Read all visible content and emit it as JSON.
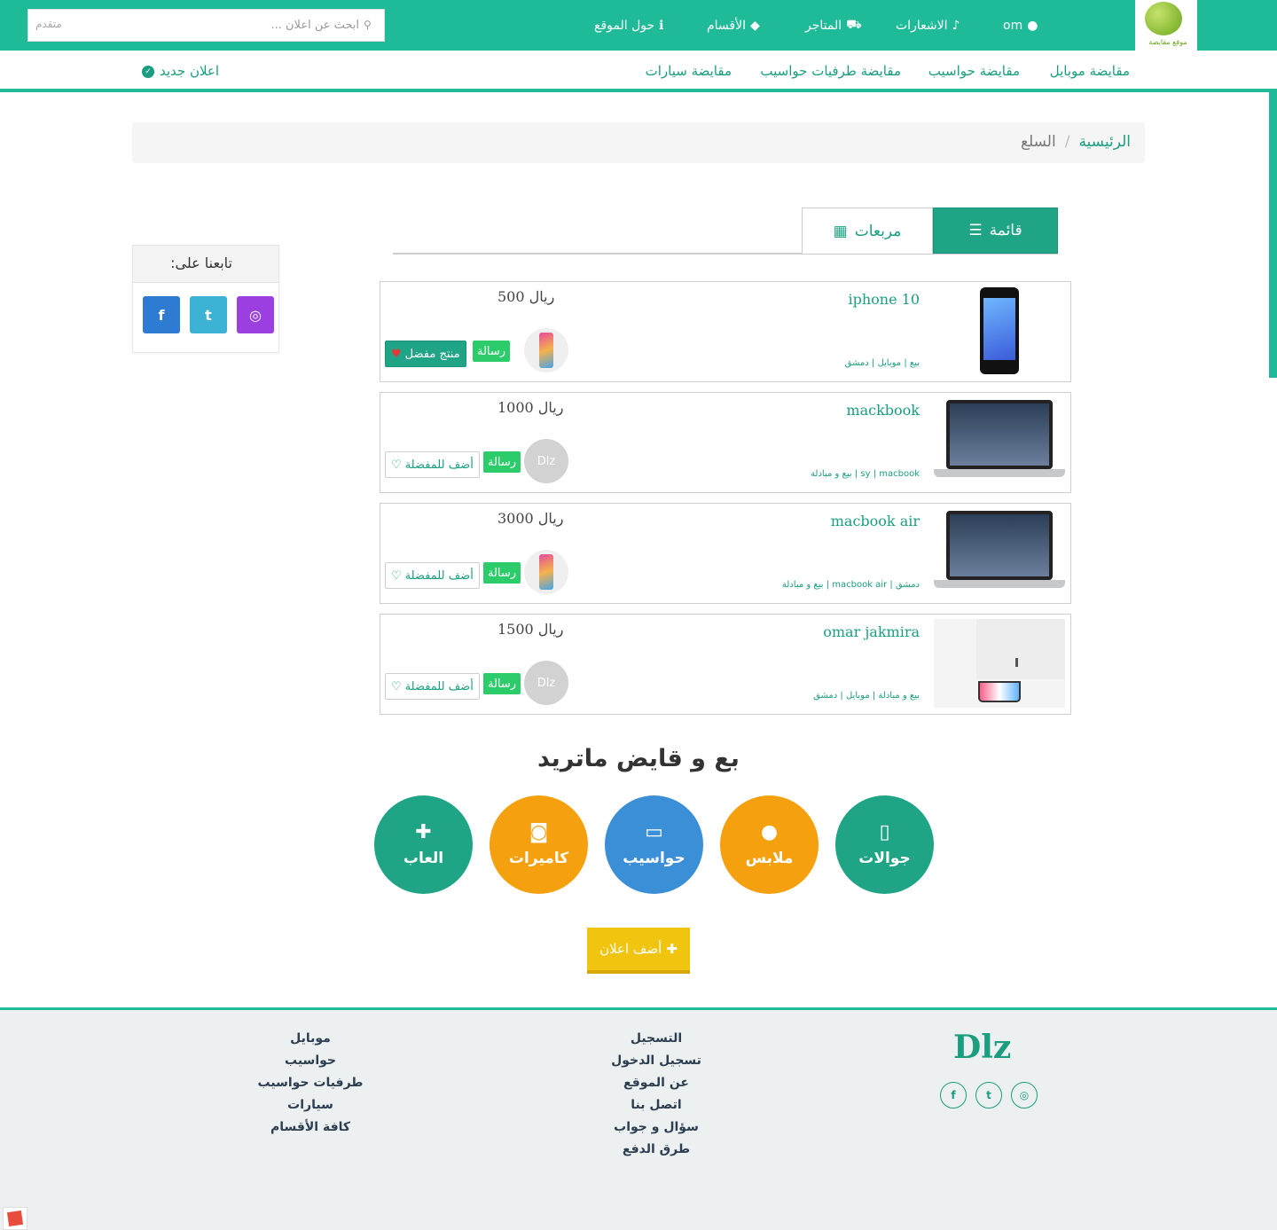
{
  "topbar": {
    "logo_text": "موقع مقايضة",
    "user": "om",
    "nav": [
      "الاشعارات",
      "المتاجر",
      "الأقسام",
      "حول الموقع"
    ],
    "search_placeholder": "ابحث عن اعلان ...",
    "advanced": "متقدم"
  },
  "subnav": {
    "items": [
      "مقايضة موبايل",
      "مقايضة حواسيب",
      "مقايضة طرفيات حواسيب",
      "مقايضة سيارات"
    ],
    "new_ad": "اعلان جديد"
  },
  "breadcrumb": {
    "home": "الرئيسية",
    "separator": "/",
    "current": "السلع"
  },
  "tabs": {
    "list": "قائمة",
    "grid": "مربعات"
  },
  "follow": {
    "title": "تابعنا على:",
    "icons": [
      "facebook-icon",
      "twitter-icon",
      "instagram-icon"
    ]
  },
  "items": [
    {
      "title": "iphone 10",
      "meta": "بيع | موبايل | دمشق",
      "price": "ريال 500",
      "avatar": "",
      "message": "رسالة",
      "favorite": "منتج مفضل",
      "favorited": true,
      "thumb": "phone"
    },
    {
      "title": "mackbook",
      "meta": "sy | macbook | بيع و مبادلة",
      "price": "ريال 1000",
      "avatar": "Dlz",
      "message": "رسالة",
      "favorite": "أضف للمفضلة",
      "favorited": false,
      "thumb": "laptop"
    },
    {
      "title": "macbook air",
      "meta": "دمشق | macbook air | بيع و مبادلة",
      "price": "ريال 3000",
      "avatar": "",
      "message": "رسالة",
      "favorite": "أضف للمفضلة",
      "favorited": false,
      "thumb": "laptop"
    },
    {
      "title": "omar jakmira",
      "meta": "بيع و مبادلة | موبايل | دمشق",
      "price": "ريال 1500",
      "avatar": "Dlz",
      "message": "رسالة",
      "favorite": "أضف للمفضلة",
      "favorited": false,
      "thumb": "blank"
    }
  ],
  "categories": {
    "heading": "بع و قايض ماتريد",
    "items": [
      {
        "label": "جوالات",
        "icon": "mobile-icon",
        "color": "#1fa585"
      },
      {
        "label": "ملابس",
        "icon": "user-icon",
        "color": "#f4a00f"
      },
      {
        "label": "حواسيب",
        "icon": "laptop-icon",
        "color": "#3b8fd6"
      },
      {
        "label": "كاميرات",
        "icon": "camera-icon",
        "color": "#f4a00f"
      },
      {
        "label": "العاب",
        "icon": "gamepad-icon",
        "color": "#1fa585"
      }
    ]
  },
  "add_ad": "أضف اعلان",
  "footer": {
    "brand": "Dlz",
    "links_col1": [
      "التسجيل",
      "تسجيل الدخول",
      "عن الموقع",
      "اتصل بنا",
      "سؤال و جواب",
      "طرق الدفع"
    ],
    "links_col2": [
      "موبايل",
      "حواسيب",
      "طرفيات حواسيب",
      "سيارات",
      "كافة الأقسام"
    ],
    "social": [
      "facebook-icon",
      "twitter-icon",
      "instagram-icon"
    ]
  },
  "colors": {
    "primary": "#1fbb98",
    "primary_dark": "#1a9e7f",
    "message_green": "#2dcc6a",
    "yellow": "#f1c40f"
  }
}
